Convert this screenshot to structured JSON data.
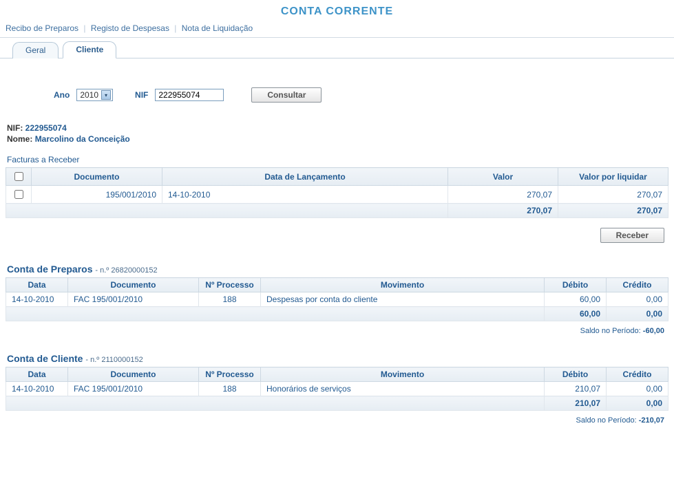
{
  "page_title": "CONTA CORRENTE",
  "breadcrumb": {
    "item1": "Recibo de Preparos",
    "item2": "Registo de Despesas",
    "item3": "Nota de Liquidação"
  },
  "tabs": {
    "geral": "Geral",
    "cliente": "Cliente"
  },
  "form": {
    "ano_label": "Ano",
    "ano_value": "2010",
    "nif_label": "NIF",
    "nif_value": "222955074",
    "consultar": "Consultar"
  },
  "client": {
    "nif_label": "NIF:",
    "nif_value": "222955074",
    "nome_label": "Nome:",
    "nome_value": "Marcolino da Conceição"
  },
  "facturas": {
    "title": "Facturas a Receber",
    "headers": {
      "documento": "Documento",
      "data": "Data de Lançamento",
      "valor": "Valor",
      "valor_liq": "Valor por liquidar"
    },
    "rows": [
      {
        "documento": "195/001/2010",
        "data": "14-10-2010",
        "valor": "270,07",
        "valor_liq": "270,07"
      }
    ],
    "totals": {
      "valor": "270,07",
      "valor_liq": "270,07"
    },
    "receber": "Receber"
  },
  "preparos": {
    "title": "Conta de Preparos",
    "sub": " - n.º 26820000152",
    "headers": {
      "data": "Data",
      "documento": "Documento",
      "processo": "Nº Processo",
      "movimento": "Movimento",
      "debito": "Débito",
      "credito": "Crédito"
    },
    "rows": [
      {
        "data": "14-10-2010",
        "documento": "FAC 195/001/2010",
        "processo": "188",
        "movimento": "Despesas por conta do cliente",
        "debito": "60,00",
        "credito": "0,00"
      }
    ],
    "totals": {
      "debito": "60,00",
      "credito": "0,00"
    },
    "saldo_label": "Saldo no Período:",
    "saldo_value": "-60,00"
  },
  "cliente_conta": {
    "title": "Conta de Cliente",
    "sub": " - n.º 2110000152",
    "headers": {
      "data": "Data",
      "documento": "Documento",
      "processo": "Nº Processo",
      "movimento": "Movimento",
      "debito": "Débito",
      "credito": "Crédito"
    },
    "rows": [
      {
        "data": "14-10-2010",
        "documento": "FAC 195/001/2010",
        "processo": "188",
        "movimento": "Honorários de serviços",
        "debito": "210,07",
        "credito": "0,00"
      }
    ],
    "totals": {
      "debito": "210,07",
      "credito": "0,00"
    },
    "saldo_label": "Saldo no Período:",
    "saldo_value": "-210,07"
  }
}
